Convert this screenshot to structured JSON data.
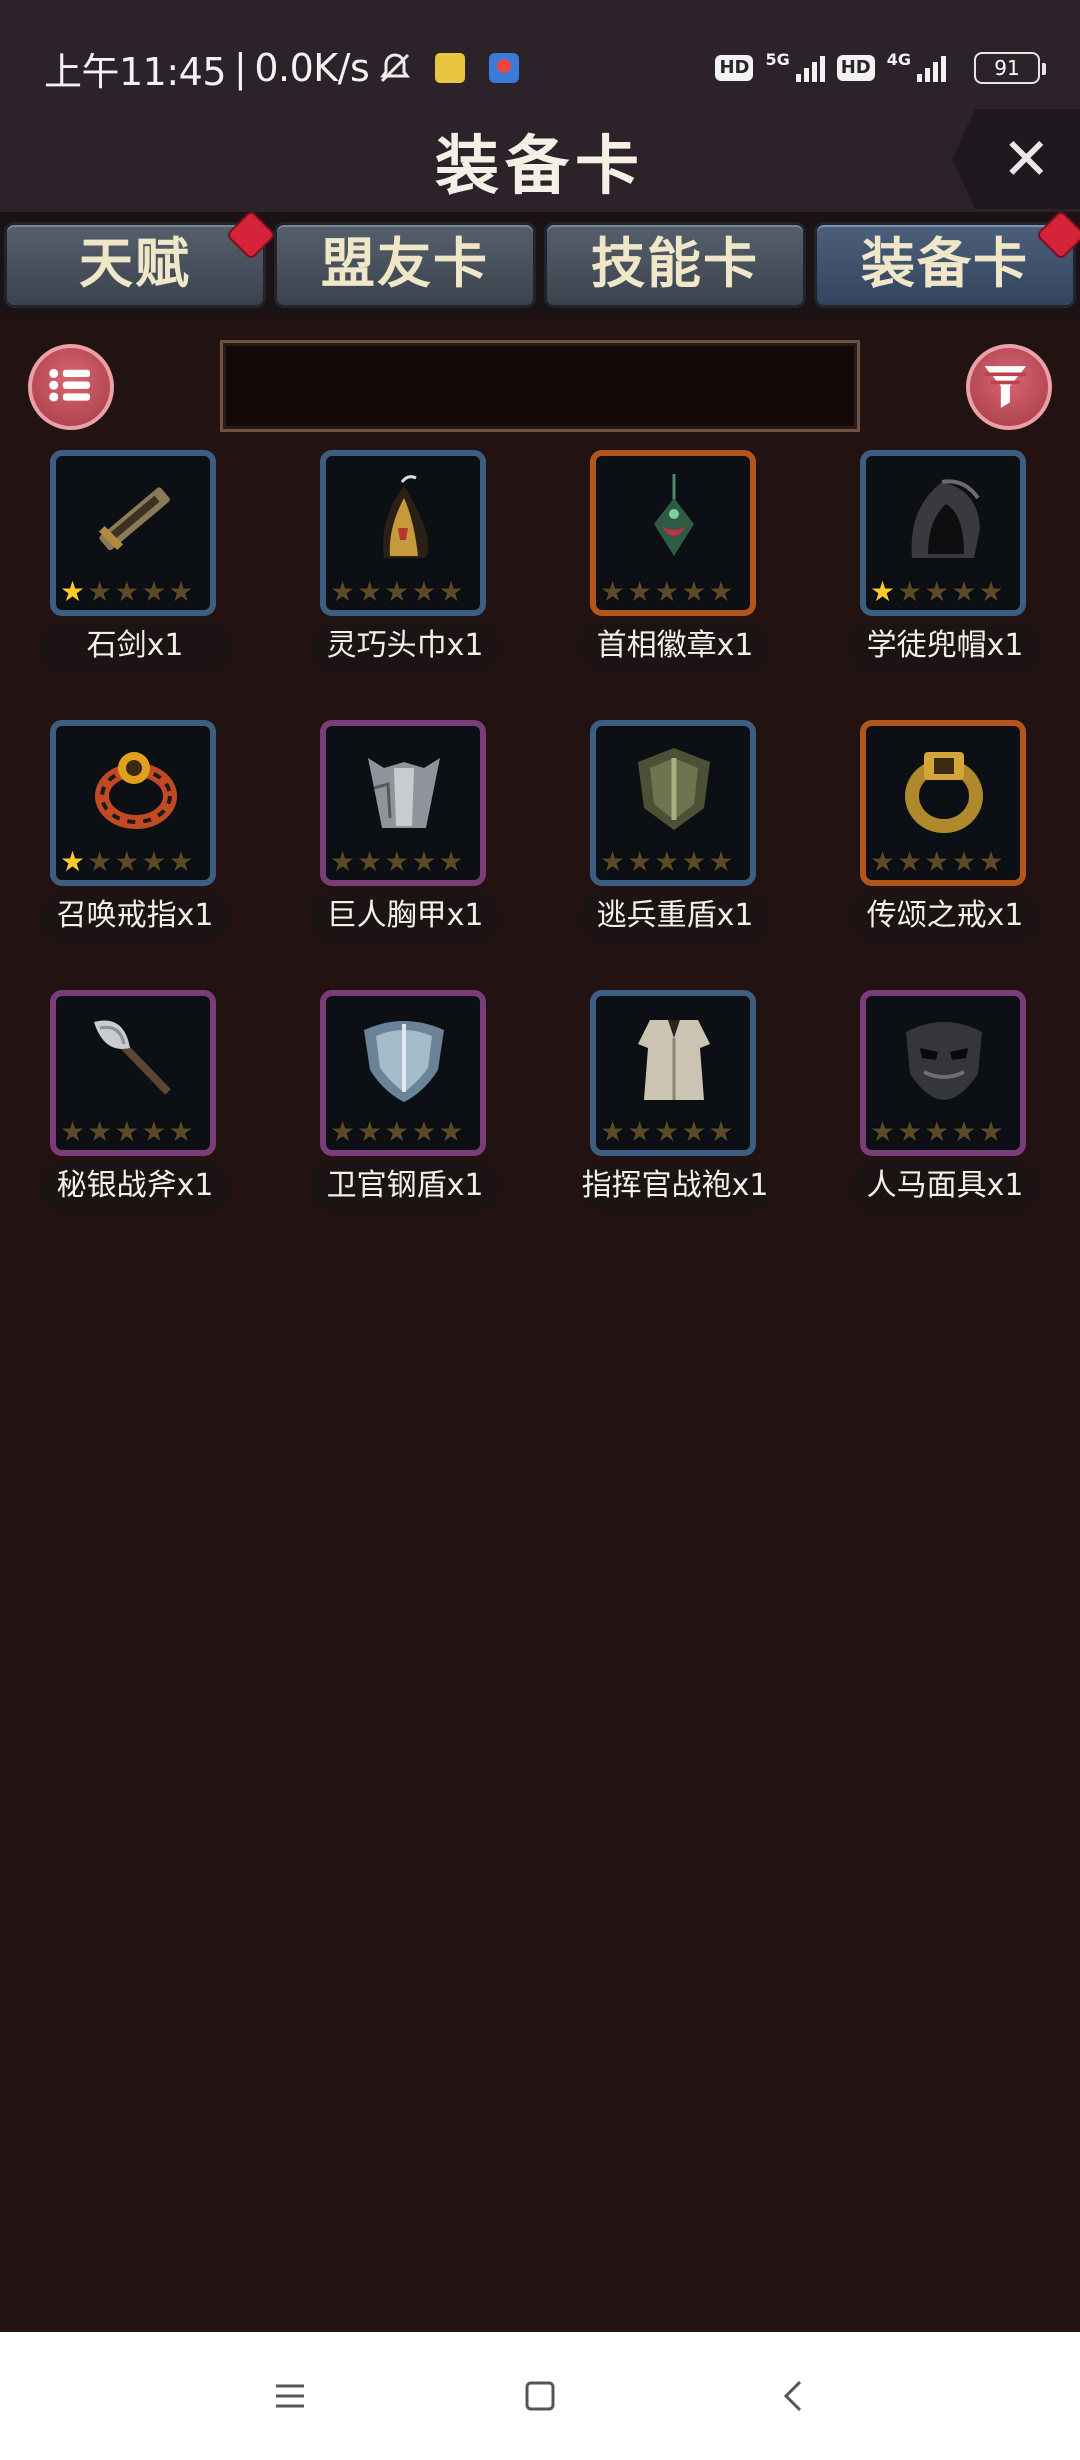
{
  "status_bar": {
    "time": "上午11:45",
    "separator": "|",
    "speed": "0.0K/s",
    "hd1": "HD",
    "net1": "5G",
    "hd2": "HD",
    "net2": "4G",
    "battery": "91"
  },
  "header": {
    "title": "装备卡",
    "close_icon": "close-icon"
  },
  "tabs": [
    {
      "label": "天赋",
      "badge": true,
      "active": false
    },
    {
      "label": "盟友卡",
      "badge": false,
      "active": false
    },
    {
      "label": "技能卡",
      "badge": false,
      "active": false
    },
    {
      "label": "装备卡",
      "badge": true,
      "active": true
    }
  ],
  "toolbar": {
    "menu_icon": "list-icon",
    "search_value": "",
    "filter_icon": "filter-icon"
  },
  "items": [
    {
      "name": "石剑x1",
      "rarity": "blue",
      "stars": 1,
      "icon": "sword-icon"
    },
    {
      "name": "灵巧头巾x1",
      "rarity": "blue",
      "stars": 0,
      "icon": "hood-icon"
    },
    {
      "name": "首相徽章x1",
      "rarity": "orange",
      "stars": 0,
      "icon": "badge-icon"
    },
    {
      "name": "学徒兜帽x1",
      "rarity": "blue",
      "stars": 1,
      "icon": "cowl-icon"
    },
    {
      "name": "召唤戒指x1",
      "rarity": "blue",
      "stars": 1,
      "icon": "ring-icon"
    },
    {
      "name": "巨人胸甲x1",
      "rarity": "purple",
      "stars": 0,
      "icon": "chestplate-icon"
    },
    {
      "name": "逃兵重盾x1",
      "rarity": "blue",
      "stars": 0,
      "icon": "heavy-shield-icon"
    },
    {
      "name": "传颂之戒x1",
      "rarity": "orange",
      "stars": 0,
      "icon": "gold-ring-icon"
    },
    {
      "name": "秘银战斧x1",
      "rarity": "purple",
      "stars": 0,
      "icon": "axe-icon"
    },
    {
      "name": "卫官钢盾x1",
      "rarity": "purple",
      "stars": 0,
      "icon": "steel-shield-icon"
    },
    {
      "name": "指挥官战袍x1",
      "rarity": "blue",
      "stars": 0,
      "icon": "robe-icon"
    },
    {
      "name": "人马面具x1",
      "rarity": "purple",
      "stars": 0,
      "icon": "mask-icon"
    }
  ],
  "nav": {
    "menu": "menu-icon",
    "home": "home-icon",
    "back": "back-icon"
  }
}
